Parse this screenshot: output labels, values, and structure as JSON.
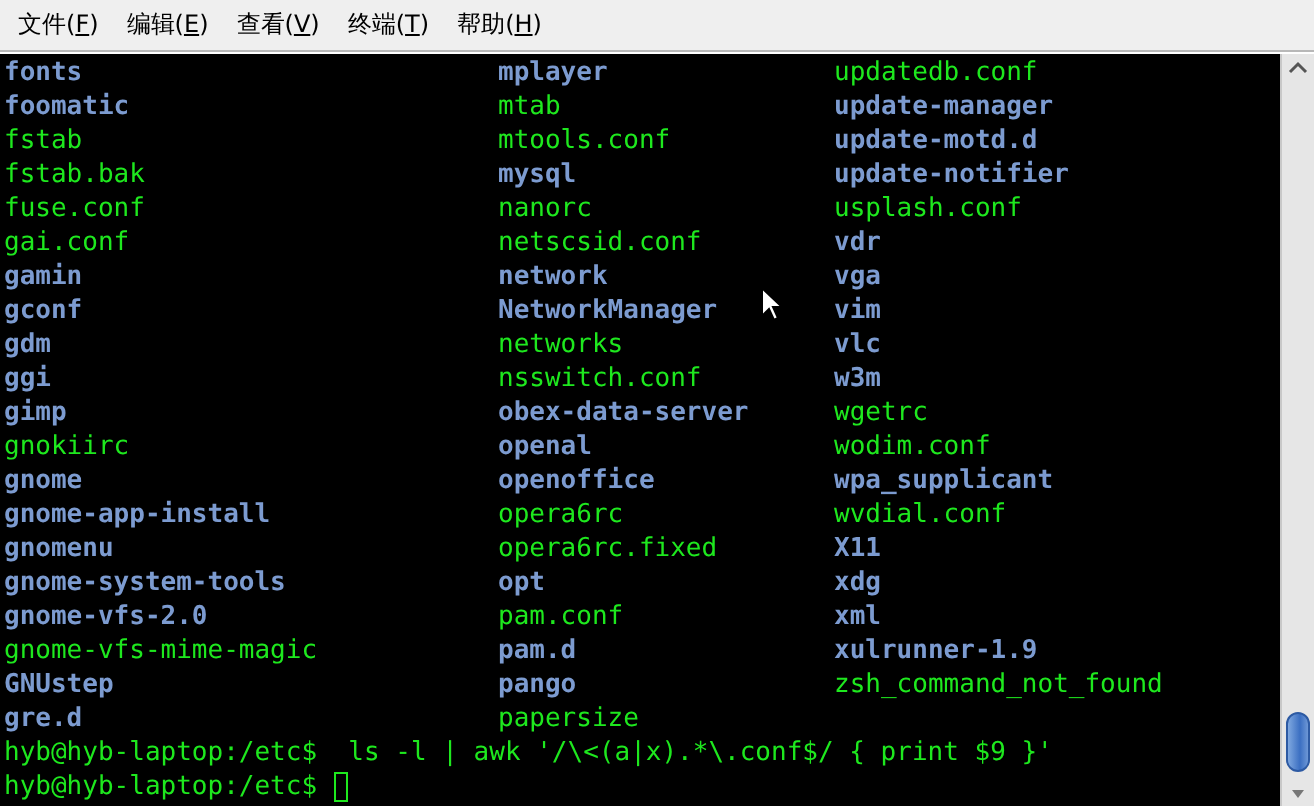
{
  "menu_bar": [
    {
      "before": "文件(",
      "mnemonic": "F",
      "after": ")"
    },
    {
      "before": "编辑(",
      "mnemonic": "E",
      "after": ")"
    },
    {
      "before": "查看(",
      "mnemonic": "V",
      "after": ")"
    },
    {
      "before": "终端(",
      "mnemonic": "T",
      "after": ")"
    },
    {
      "before": "帮助(",
      "mnemonic": "H",
      "after": ")"
    }
  ],
  "listing": {
    "columns": [
      [
        {
          "name": "fonts",
          "kind": "dir"
        },
        {
          "name": "foomatic",
          "kind": "dir"
        },
        {
          "name": "fstab",
          "kind": "file"
        },
        {
          "name": "fstab.bak",
          "kind": "file"
        },
        {
          "name": "fuse.conf",
          "kind": "file"
        },
        {
          "name": "gai.conf",
          "kind": "file"
        },
        {
          "name": "gamin",
          "kind": "dir"
        },
        {
          "name": "gconf",
          "kind": "dir"
        },
        {
          "name": "gdm",
          "kind": "dir"
        },
        {
          "name": "ggi",
          "kind": "dir"
        },
        {
          "name": "gimp",
          "kind": "dir"
        },
        {
          "name": "gnokiirc",
          "kind": "file"
        },
        {
          "name": "gnome",
          "kind": "dir"
        },
        {
          "name": "gnome-app-install",
          "kind": "dir"
        },
        {
          "name": "gnomenu",
          "kind": "dir"
        },
        {
          "name": "gnome-system-tools",
          "kind": "dir"
        },
        {
          "name": "gnome-vfs-2.0",
          "kind": "dir"
        },
        {
          "name": "gnome-vfs-mime-magic",
          "kind": "file"
        },
        {
          "name": "GNUstep",
          "kind": "dir"
        },
        {
          "name": "gre.d",
          "kind": "dir"
        }
      ],
      [
        {
          "name": "mplayer",
          "kind": "dir"
        },
        {
          "name": "mtab",
          "kind": "file"
        },
        {
          "name": "mtools.conf",
          "kind": "file"
        },
        {
          "name": "mysql",
          "kind": "dir"
        },
        {
          "name": "nanorc",
          "kind": "file"
        },
        {
          "name": "netscsid.conf",
          "kind": "file"
        },
        {
          "name": "network",
          "kind": "dir"
        },
        {
          "name": "NetworkManager",
          "kind": "dir"
        },
        {
          "name": "networks",
          "kind": "file"
        },
        {
          "name": "nsswitch.conf",
          "kind": "file"
        },
        {
          "name": "obex-data-server",
          "kind": "dir"
        },
        {
          "name": "openal",
          "kind": "dir"
        },
        {
          "name": "openoffice",
          "kind": "dir"
        },
        {
          "name": "opera6rc",
          "kind": "file"
        },
        {
          "name": "opera6rc.fixed",
          "kind": "file"
        },
        {
          "name": "opt",
          "kind": "dir"
        },
        {
          "name": "pam.conf",
          "kind": "file"
        },
        {
          "name": "pam.d",
          "kind": "dir"
        },
        {
          "name": "pango",
          "kind": "dir"
        },
        {
          "name": "papersize",
          "kind": "file"
        }
      ],
      [
        {
          "name": "updatedb.conf",
          "kind": "file"
        },
        {
          "name": "update-manager",
          "kind": "dir"
        },
        {
          "name": "update-motd.d",
          "kind": "dir"
        },
        {
          "name": "update-notifier",
          "kind": "dir"
        },
        {
          "name": "usplash.conf",
          "kind": "file"
        },
        {
          "name": "vdr",
          "kind": "dir"
        },
        {
          "name": "vga",
          "kind": "dir"
        },
        {
          "name": "vim",
          "kind": "dir"
        },
        {
          "name": "vlc",
          "kind": "dir"
        },
        {
          "name": "w3m",
          "kind": "dir"
        },
        {
          "name": "wgetrc",
          "kind": "file"
        },
        {
          "name": "wodim.conf",
          "kind": "file"
        },
        {
          "name": "wpa_supplicant",
          "kind": "dir"
        },
        {
          "name": "wvdial.conf",
          "kind": "file"
        },
        {
          "name": "X11",
          "kind": "dir"
        },
        {
          "name": "xdg",
          "kind": "dir"
        },
        {
          "name": "xml",
          "kind": "dir"
        },
        {
          "name": "xulrunner-1.9",
          "kind": "dir"
        },
        {
          "name": "zsh_command_not_found",
          "kind": "file"
        }
      ]
    ]
  },
  "command_lines": [
    {
      "prompt": "hyb@hyb-laptop:/etc$",
      "command": "  ls -l | awk '/\\<(a|x).*\\.conf$/ { print $9 }'",
      "cursor": false
    },
    {
      "prompt": "hyb@hyb-laptop:/etc$",
      "cursor": true
    }
  ]
}
